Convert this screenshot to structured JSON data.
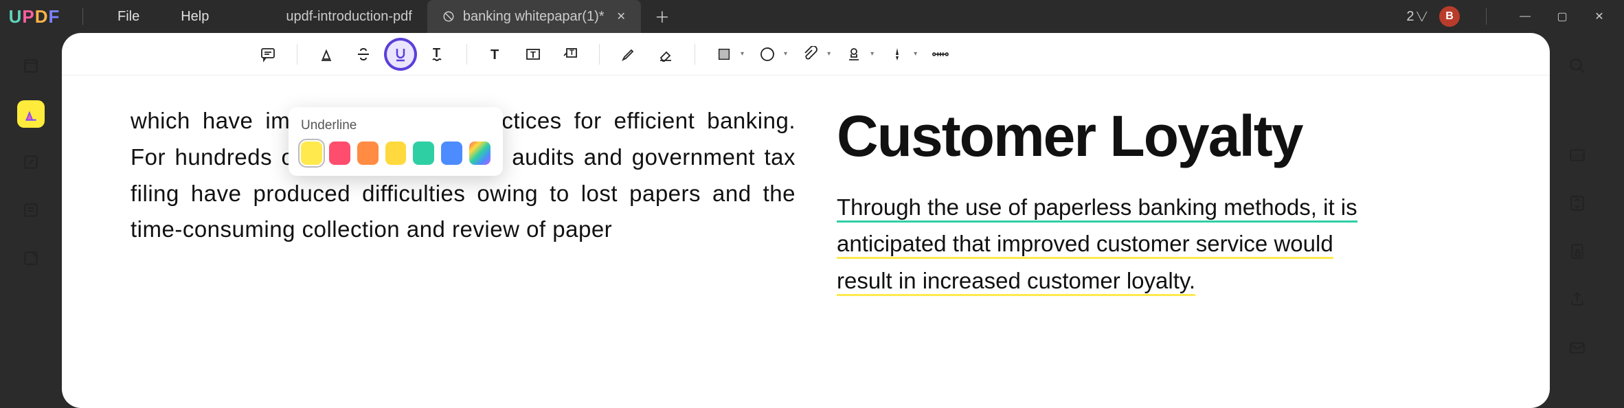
{
  "app": {
    "logo": "UPDF"
  },
  "menu": {
    "file": "File",
    "help": "Help"
  },
  "tabs": {
    "inactive": "updf-introduction-pdf",
    "active": "banking whitepapar(1)*"
  },
  "window": {
    "count_label": "2",
    "avatar_initial": "B"
  },
  "popup": {
    "title": "Underline"
  },
  "content": {
    "left_para": "which have implemented best practices for efficient banking. For hundreds of years, paper base audits and government tax filing have produced difficulties owing to lost papers and the time-consuming collection and review of paper",
    "heading": "Customer Loyalty",
    "r1": "Through the use of paperless banking methods, it is",
    "r2": "anticipated that improved customer service would",
    "r3": "result in increased customer loyalty."
  }
}
